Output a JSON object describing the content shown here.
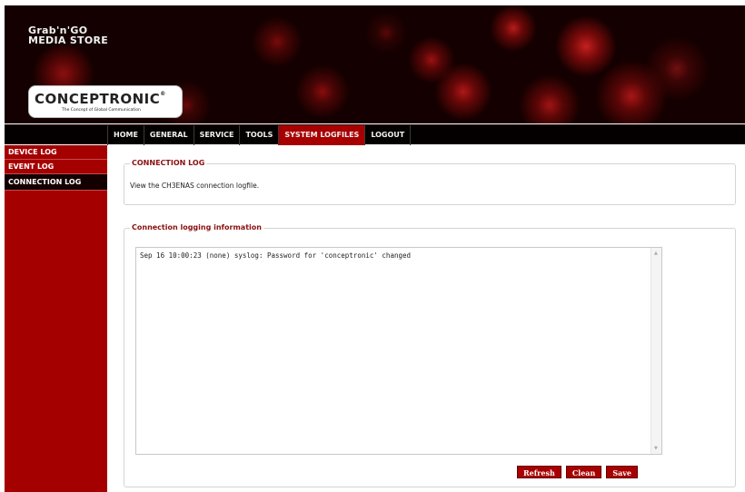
{
  "header": {
    "store_name_line1": "Grab'n'GO",
    "store_name_line2": "MEDIA STORE",
    "logo_text": "CONCEPTRONIC",
    "logo_reg": "®",
    "logo_tagline": "The Concept of Global Communication"
  },
  "nav": {
    "items": [
      {
        "label": "HOME"
      },
      {
        "label": "GENERAL"
      },
      {
        "label": "SERVICE"
      },
      {
        "label": "TOOLS"
      },
      {
        "label": "SYSTEM LOGFILES"
      },
      {
        "label": "LOGOUT"
      }
    ],
    "active": "SYSTEM LOGFILES"
  },
  "sidebar": {
    "items": [
      {
        "label": "DEVICE LOG"
      },
      {
        "label": "EVENT LOG"
      },
      {
        "label": "CONNECTION LOG"
      }
    ],
    "active": "CONNECTION LOG"
  },
  "connection_panel": {
    "title": "CONNECTION LOG",
    "description": "View the CH3ENAS connection logfile."
  },
  "logging_panel": {
    "title": "Connection logging information",
    "log_text": "Sep 16 10:00:23 (none) syslog: Password for 'conceptronic' changed",
    "buttons": {
      "refresh": "Refresh",
      "clean": "Clean",
      "save": "Save"
    }
  },
  "colors": {
    "accent": "#a80000",
    "nav_bg": "#050000",
    "legend_text": "#8a1010"
  },
  "icons": {
    "scroll_up": "scroll-up-arrow-icon",
    "scroll_down": "scroll-down-arrow-icon"
  }
}
